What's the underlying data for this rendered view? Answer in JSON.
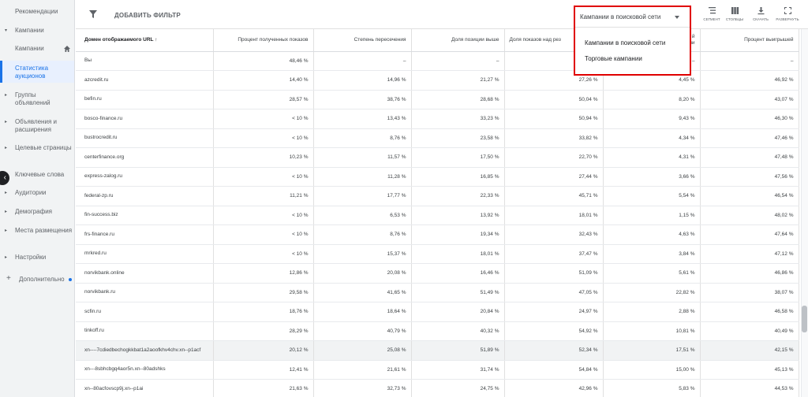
{
  "sidebar": {
    "items": [
      {
        "label": "Рекомендации"
      },
      {
        "label": "Кампании"
      },
      {
        "label": "Кампании"
      },
      {
        "label": "Статистика аукционов"
      },
      {
        "label": "Группы объявлений"
      },
      {
        "label": "Объявления и расширения"
      },
      {
        "label": "Целевые страницы"
      },
      {
        "label": "Ключевые слова"
      },
      {
        "label": "Аудитории"
      },
      {
        "label": "Демография"
      },
      {
        "label": "Места размещения"
      },
      {
        "label": "Настройки"
      },
      {
        "label": "Дополнительно"
      }
    ]
  },
  "toolbar": {
    "add_filter": "ДОБАВИТЬ ФИЛЬТР",
    "segment": "СЕГМЕНТ",
    "columns": "СТОЛБЦЫ",
    "download": "СКАЧАТЬ",
    "expand": "РАЗВЕРНУТЬ"
  },
  "campaign_select": {
    "selected": "Кампании в поисковой сети",
    "options": [
      "Кампании в поисковой сети",
      "Торговые кампании"
    ]
  },
  "table": {
    "headers": [
      "Домен отображаемого URL ↑",
      "Процент полученных показов",
      "Степень пересечения",
      "Доля позиции выше",
      "Доля показов над рез",
      "й\nии",
      "Процент выигрышей"
    ],
    "rows": [
      [
        "Вы",
        "48,46 %",
        "–",
        "–",
        "–",
        "–",
        "–"
      ],
      [
        "azcredit.ru",
        "14,40 %",
        "14,96 %",
        "21,27 %",
        "27,26 %",
        "4,45 %",
        "46,92 %"
      ],
      [
        "befin.ru",
        "28,57 %",
        "38,76 %",
        "28,68 %",
        "50,04 %",
        "8,20 %",
        "43,07 %"
      ],
      [
        "bosco-finance.ru",
        "< 10 %",
        "13,43 %",
        "33,23 %",
        "50,94 %",
        "9,43 %",
        "46,30 %"
      ],
      [
        "bustrocredit.ru",
        "< 10 %",
        "8,76 %",
        "23,58 %",
        "33,82 %",
        "4,34 %",
        "47,46 %"
      ],
      [
        "centerfinance.org",
        "10,23 %",
        "11,57 %",
        "17,50 %",
        "22,70 %",
        "4,31 %",
        "47,48 %"
      ],
      [
        "express-zalog.ru",
        "< 10 %",
        "11,28 %",
        "16,85 %",
        "27,44 %",
        "3,66 %",
        "47,56 %"
      ],
      [
        "federal-zp.ru",
        "11,21 %",
        "17,77 %",
        "22,33 %",
        "45,71 %",
        "5,54 %",
        "46,54 %"
      ],
      [
        "fin-success.biz",
        "< 10 %",
        "6,53 %",
        "13,92 %",
        "18,01 %",
        "1,15 %",
        "48,02 %"
      ],
      [
        "frs-finance.ru",
        "< 10 %",
        "8,76 %",
        "19,34 %",
        "32,43 %",
        "4,63 %",
        "47,64 %"
      ],
      [
        "mrkred.ru",
        "< 10 %",
        "15,37 %",
        "18,01 %",
        "37,47 %",
        "3,84 %",
        "47,12 %"
      ],
      [
        "norvikbank.online",
        "12,86 %",
        "20,08 %",
        "16,46 %",
        "51,09 %",
        "5,61 %",
        "46,86 %"
      ],
      [
        "norvikbank.ru",
        "29,58 %",
        "41,65 %",
        "51,49 %",
        "47,05 %",
        "22,82 %",
        "38,07 %"
      ],
      [
        "scfin.ru",
        "18,76 %",
        "18,64 %",
        "20,84 %",
        "24,97 %",
        "2,88 %",
        "46,58 %"
      ],
      [
        "tinkoff.ru",
        "28,29 %",
        "40,79 %",
        "40,32 %",
        "54,92 %",
        "10,81 %",
        "40,49 %"
      ],
      [
        "xn----7cdiedbechogkkbat1a2aoofkhv4chv.xn--p1acf",
        "20,12 %",
        "25,08 %",
        "51,89 %",
        "52,34 %",
        "17,51 %",
        "42,15 %"
      ],
      [
        "xn---8sbhcbgq4aor5n.xn--80adshks",
        "12,41 %",
        "21,61 %",
        "31,74 %",
        "54,84 %",
        "15,00 %",
        "45,13 %"
      ],
      [
        "xn--80acfovscp9j.xn--p1ai",
        "21,63 %",
        "32,73 %",
        "24,75 %",
        "42,96 %",
        "5,83 %",
        "44,53 %"
      ]
    ]
  }
}
